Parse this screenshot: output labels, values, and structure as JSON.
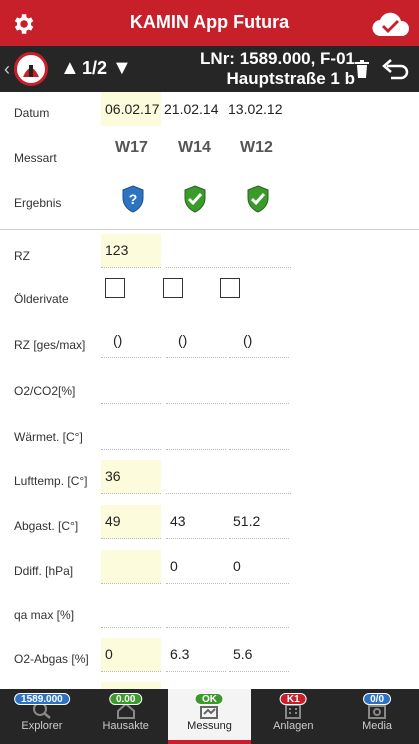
{
  "header": {
    "title": "KAMIN App Futura",
    "settings_icon": "gear-icon",
    "sync_icon": "cloud-check-icon"
  },
  "subbar": {
    "page_indicator": "1/2",
    "lnr_line1": "LNr: 1589.000, F-01",
    "lnr_line2": "Hauptstraße 1 b"
  },
  "meta": {
    "label_datum": "Datum",
    "label_messart": "Messart",
    "label_ergebnis": "Ergebnis",
    "dates": [
      "06.02.17",
      "21.02.14",
      "13.02.12"
    ],
    "messart": [
      "W17",
      "W14",
      "W12"
    ],
    "ergebnis": [
      "question",
      "ok",
      "ok"
    ]
  },
  "rows": {
    "rz": {
      "label": "RZ",
      "values": [
        "123",
        "",
        ""
      ]
    },
    "oelderivate": {
      "label": "Ölderivate"
    },
    "rz_ges": {
      "label": "RZ [ges/max]",
      "values": [
        "()",
        "()",
        "()"
      ]
    },
    "o2co2": {
      "label": "O2/CO2[%]",
      "values": [
        "",
        "",
        ""
      ]
    },
    "waermet": {
      "label": "Wärmet. [C°]",
      "values": [
        "",
        "",
        ""
      ]
    },
    "lufttemp": {
      "label": "Lufttemp. [C°]",
      "values": [
        "36",
        "",
        ""
      ]
    },
    "abgast": {
      "label": "Abgast. [C°]",
      "values": [
        "49",
        "43",
        "51.2"
      ]
    },
    "ddiff": {
      "label": "Ddiff. [hPa]",
      "values": [
        "",
        "0",
        "0"
      ]
    },
    "qamax": {
      "label": "qa max [%]",
      "values": [
        "",
        "",
        ""
      ]
    },
    "o2abgas": {
      "label": "O2-Abgas [%]",
      "values": [
        "0",
        "6.3",
        "5.6"
      ]
    }
  },
  "tabs": [
    {
      "label": "Explorer",
      "badge": "1589.000",
      "badge_color": "#2d73c2",
      "icon": "search-icon"
    },
    {
      "label": "Hausakte",
      "badge": "0.00",
      "badge_color": "#3b9a2b",
      "icon": "house-file-icon"
    },
    {
      "label": "Messung",
      "badge": "OK",
      "badge_color": "#3b9a2b",
      "icon": "measure-icon",
      "active": true
    },
    {
      "label": "Anlagen",
      "badge": "K1",
      "badge_color": "#c8202b",
      "icon": "building-icon"
    },
    {
      "label": "Media",
      "badge": "0/0",
      "badge_color": "#2d73c2",
      "icon": "media-icon"
    }
  ],
  "colors": {
    "brand_red": "#c8202b",
    "bar_dark": "#262626",
    "highlight": "#fcfbdc"
  }
}
